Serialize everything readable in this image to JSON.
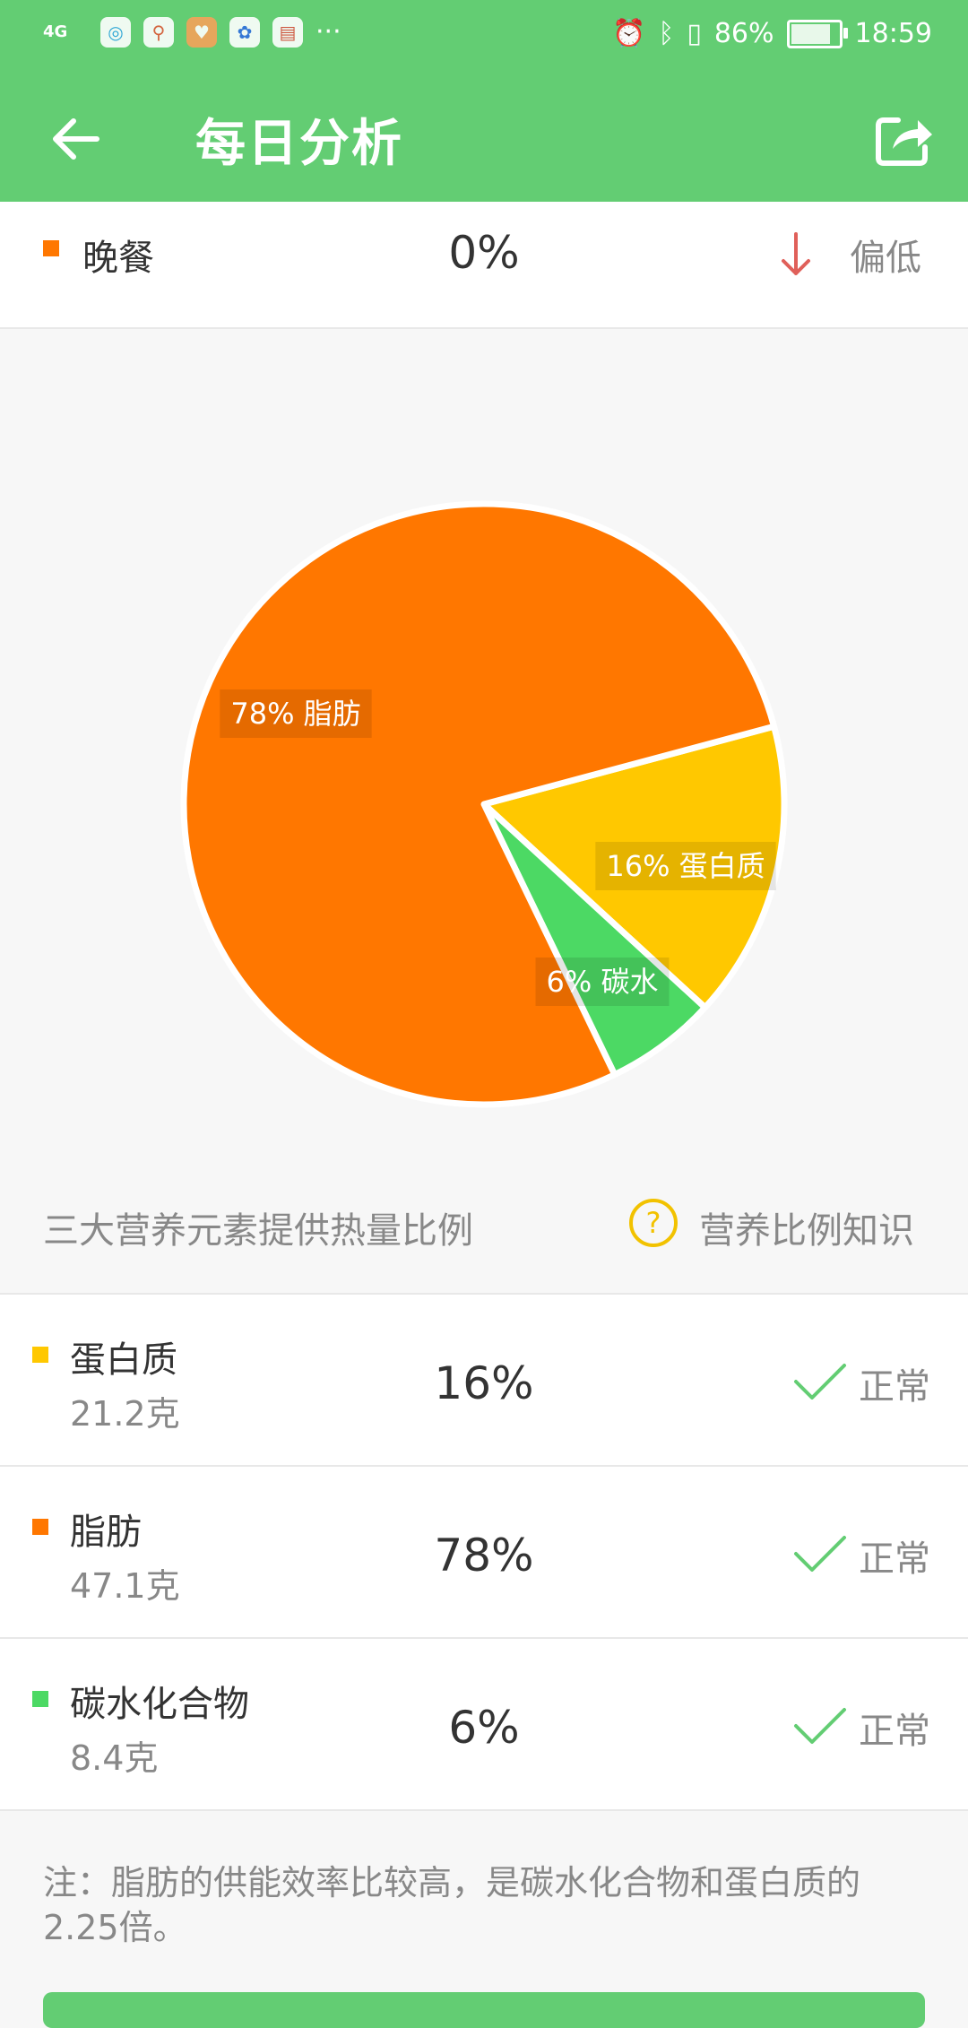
{
  "status_bar": {
    "network": "4G",
    "more": "···",
    "battery": "86%",
    "battery_level": 86,
    "time": "18:59"
  },
  "app_bar": {
    "title": "每日分析"
  },
  "dinner_row": {
    "label": "晚餐",
    "percent": "0%",
    "status": "偏低",
    "color": "#ff7700"
  },
  "chart_data": {
    "type": "pie",
    "slices": [
      {
        "label": "78% 脂肪",
        "value": 78,
        "color": "#ff7700"
      },
      {
        "label": "16% 蛋白质",
        "value": 16,
        "color": "#ffc800"
      },
      {
        "label": "6% 碳水",
        "value": 6,
        "color": "#4cd964"
      }
    ]
  },
  "chart_caption": "三大营养元素提供热量比例",
  "help_link": "营养比例知识",
  "nutrients": [
    {
      "name": "蛋白质",
      "amount": "21.2克",
      "percent": "16%",
      "status": "正常",
      "color": "#ffc800"
    },
    {
      "name": "脂肪",
      "amount": "47.1克",
      "percent": "78%",
      "status": "正常",
      "color": "#ff7700"
    },
    {
      "name": "碳水化合物",
      "amount": "8.4克",
      "percent": "6%",
      "status": "正常",
      "color": "#4cd964"
    }
  ],
  "note": "注：脂肪的供能效率比较高，是碳水化合物和蛋白质的2.25倍。",
  "colors": {
    "primary": "#63cd73",
    "check": "#63cd73",
    "down_arrow": "#e0605a",
    "help": "#f2c200"
  }
}
